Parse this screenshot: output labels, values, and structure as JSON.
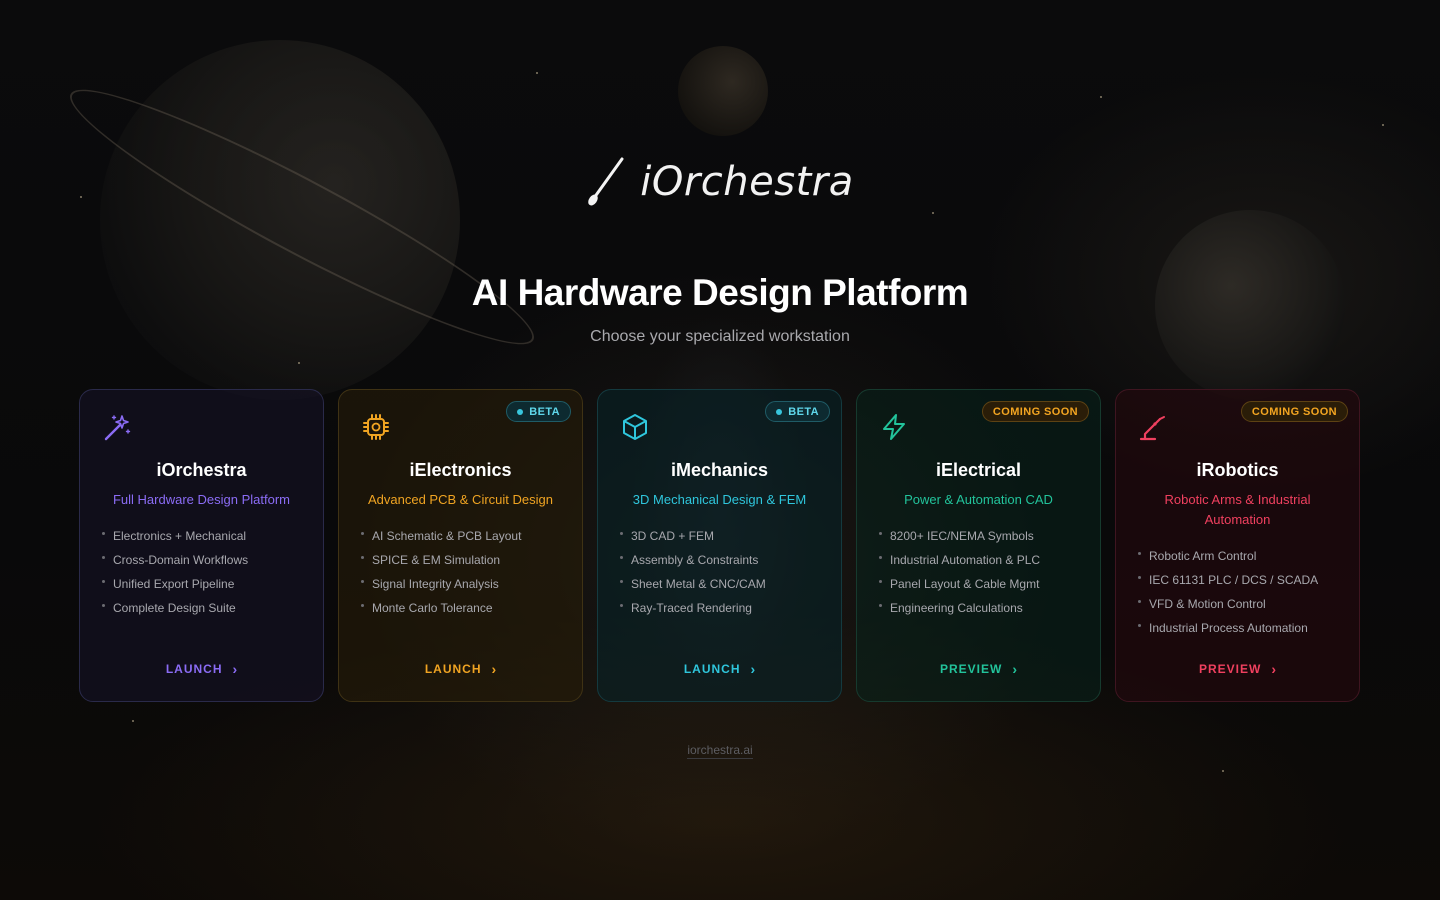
{
  "brand": {
    "name": "iOrchestra"
  },
  "hero": {
    "title": "AI Hardware Design Platform",
    "subtitle": "Choose your specialized workstation"
  },
  "cards": [
    {
      "title": "iOrchestra",
      "tagline": "Full Hardware Design Platform",
      "icon": "magic-wand-icon",
      "accent": "#8b6cf5",
      "badge": "",
      "features": [
        "Electronics + Mechanical",
        "Cross-Domain Workflows",
        "Unified Export Pipeline",
        "Complete Design Suite"
      ],
      "cta": "LAUNCH"
    },
    {
      "title": "iElectronics",
      "tagline": "Advanced PCB & Circuit Design",
      "icon": "chip-icon",
      "accent": "#f0a422",
      "badge": "BETA",
      "features": [
        "AI Schematic & PCB Layout",
        "SPICE & EM Simulation",
        "Signal Integrity Analysis",
        "Monte Carlo Tolerance"
      ],
      "cta": "LAUNCH"
    },
    {
      "title": "iMechanics",
      "tagline": "3D Mechanical Design & FEM",
      "icon": "cube-icon",
      "accent": "#2fc6dc",
      "badge": "BETA",
      "features": [
        "3D CAD + FEM",
        "Assembly & Constraints",
        "Sheet Metal & CNC/CAM",
        "Ray-Traced Rendering"
      ],
      "cta": "LAUNCH"
    },
    {
      "title": "iElectrical",
      "tagline": "Power & Automation CAD",
      "icon": "lightning-icon",
      "accent": "#22c39b",
      "badge": "COMING SOON",
      "features": [
        "8200+ IEC/NEMA Symbols",
        "Industrial Automation & PLC",
        "Panel Layout & Cable Mgmt",
        "Engineering Calculations"
      ],
      "cta": "PREVIEW"
    },
    {
      "title": "iRobotics",
      "tagline": "Robotic Arms & Industrial Automation",
      "icon": "robot-arm-icon",
      "accent": "#f0405f",
      "badge": "COMING SOON",
      "features": [
        "Robotic Arm Control",
        "IEC 61131 PLC / DCS / SCADA",
        "VFD & Motion Control",
        "Industrial Process Automation"
      ],
      "cta": "PREVIEW"
    }
  ],
  "footer": {
    "link": "iorchestra.ai"
  }
}
